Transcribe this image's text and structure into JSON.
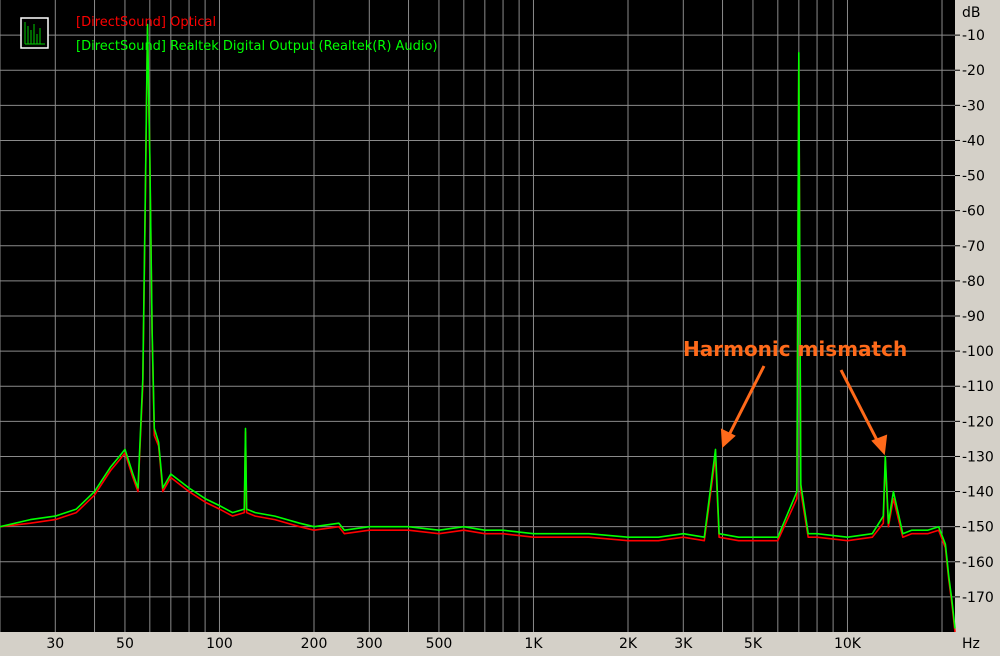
{
  "colors": {
    "background": "#000000",
    "frame": "#d4d0c8",
    "grid": "#8a8a8a",
    "series_optical": "#ff0000",
    "series_realtek": "#00ff00",
    "annotation": "#ff6a1a"
  },
  "chart_data": {
    "type": "line",
    "title": "",
    "xlabel": "Hz",
    "ylabel": "dB",
    "x_scale": "log",
    "xlim": [
      20,
      22000
    ],
    "ylim": [
      -180,
      0
    ],
    "grid": true,
    "legend_placement": "top-left",
    "x_ticks": [
      {
        "value": 30,
        "label": "30"
      },
      {
        "value": 50,
        "label": "50"
      },
      {
        "value": 100,
        "label": "100"
      },
      {
        "value": 200,
        "label": "200"
      },
      {
        "value": 300,
        "label": "300"
      },
      {
        "value": 500,
        "label": "500"
      },
      {
        "value": 1000,
        "label": "1K"
      },
      {
        "value": 2000,
        "label": "2K"
      },
      {
        "value": 3000,
        "label": "3K"
      },
      {
        "value": 5000,
        "label": "5K"
      },
      {
        "value": 10000,
        "label": "10K"
      }
    ],
    "y_ticks": [
      -10,
      -20,
      -30,
      -40,
      -50,
      -60,
      -70,
      -80,
      -90,
      -100,
      -110,
      -120,
      -130,
      -140,
      -150,
      -160,
      -170
    ],
    "series": [
      {
        "name": "[DirectSound] Optical",
        "color": "#ff0000",
        "x": [
          20,
          25,
          30,
          35,
          40,
          45,
          48,
          50,
          53,
          55,
          57,
          58,
          59,
          60,
          61,
          62,
          64,
          66,
          70,
          80,
          90,
          100,
          110,
          120,
          121,
          122,
          130,
          150,
          180,
          200,
          240,
          250,
          300,
          400,
          500,
          600,
          700,
          800,
          1000,
          1500,
          2000,
          2500,
          3000,
          3500,
          3800,
          3900,
          4500,
          6000,
          6900,
          7000,
          7100,
          7500,
          8000,
          10000,
          12000,
          13000,
          13200,
          13500,
          14000,
          15000,
          16000,
          18000,
          19500,
          20500,
          21000,
          21500,
          22000
        ],
        "y": [
          -150,
          -149,
          -148,
          -146,
          -141,
          -134,
          -131,
          -129,
          -136,
          -140,
          -110,
          -60,
          -8,
          -45,
          -95,
          -124,
          -127,
          -140,
          -136,
          -140,
          -143,
          -145,
          -147,
          -146,
          -123,
          -146,
          -147,
          -148,
          -150,
          -151,
          -150,
          -152,
          -151,
          -151,
          -152,
          -151,
          -152,
          -152,
          -153,
          -153,
          -154,
          -154,
          -153,
          -154,
          -130,
          -153,
          -154,
          -154,
          -142,
          -17,
          -140,
          -153,
          -153,
          -154,
          -153,
          -149,
          -131,
          -150,
          -142,
          -153,
          -152,
          -152,
          -151,
          -156,
          -165,
          -172,
          -180
        ]
      },
      {
        "name": "[DirectSound] Realtek Digital Output (Realtek(R) Audio)",
        "color": "#00ff00",
        "x": [
          20,
          25,
          30,
          35,
          40,
          45,
          48,
          50,
          53,
          55,
          57,
          58,
          59,
          60,
          61,
          62,
          64,
          66,
          70,
          80,
          90,
          100,
          110,
          120,
          121,
          122,
          130,
          150,
          180,
          200,
          240,
          250,
          300,
          400,
          500,
          600,
          700,
          800,
          1000,
          1500,
          2000,
          2500,
          3000,
          3500,
          3800,
          3900,
          4500,
          6000,
          6900,
          7000,
          7100,
          7500,
          8000,
          10000,
          12000,
          13000,
          13200,
          13500,
          14000,
          15000,
          16000,
          18000,
          19500,
          20500,
          21000,
          21500,
          22000
        ],
        "y": [
          -150,
          -148,
          -147,
          -145,
          -140,
          -133,
          -130,
          -128,
          -135,
          -139,
          -108,
          -58,
          -7,
          -44,
          -94,
          -122,
          -126,
          -139,
          -135,
          -139,
          -142,
          -144,
          -146,
          -145,
          -122,
          -145,
          -146,
          -147,
          -149,
          -150,
          -149,
          -151,
          -150,
          -150,
          -151,
          -150,
          -151,
          -151,
          -152,
          -152,
          -153,
          -153,
          -152,
          -153,
          -128,
          -152,
          -153,
          -153,
          -140,
          -15,
          -138,
          -152,
          -152,
          -153,
          -152,
          -147,
          -130,
          -149,
          -140,
          -152,
          -151,
          -151,
          -150,
          -155,
          -164,
          -171,
          -179
        ]
      }
    ],
    "annotations": [
      {
        "text": "Harmonic mismatch",
        "arrow_targets_hz": [
          3800,
          13200
        ]
      }
    ]
  }
}
